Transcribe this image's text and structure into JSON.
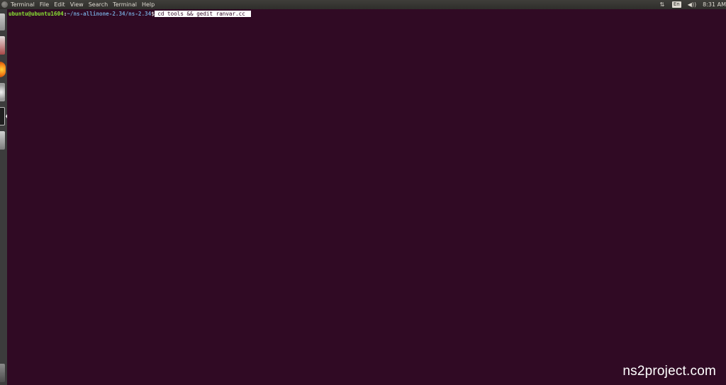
{
  "menubar": {
    "app_name": "Terminal",
    "menus": [
      "File",
      "Edit",
      "View",
      "Search",
      "Terminal",
      "Help"
    ],
    "indicators": {
      "network_icon": "network-transfer-icon",
      "keyboard_layout": "En",
      "volume_icon": "volume-icon",
      "clock": "8:31 AM"
    }
  },
  "launcher": {
    "items": [
      "files-icon",
      "document-viewer-icon",
      "firefox-icon",
      "system-settings-icon",
      "terminal-icon",
      "tools-icon",
      "trash-icon"
    ]
  },
  "terminal": {
    "prompt_user_host": "ubuntu@ubuntu1604",
    "prompt_separator": ":",
    "prompt_path": "~/ns-allinone-2.34/ns-2.34",
    "prompt_symbol": "$",
    "command": " cd tools && gedit ranvar.cc",
    "background_color": "#300a24"
  },
  "watermark": {
    "text": "ns2project.com"
  }
}
